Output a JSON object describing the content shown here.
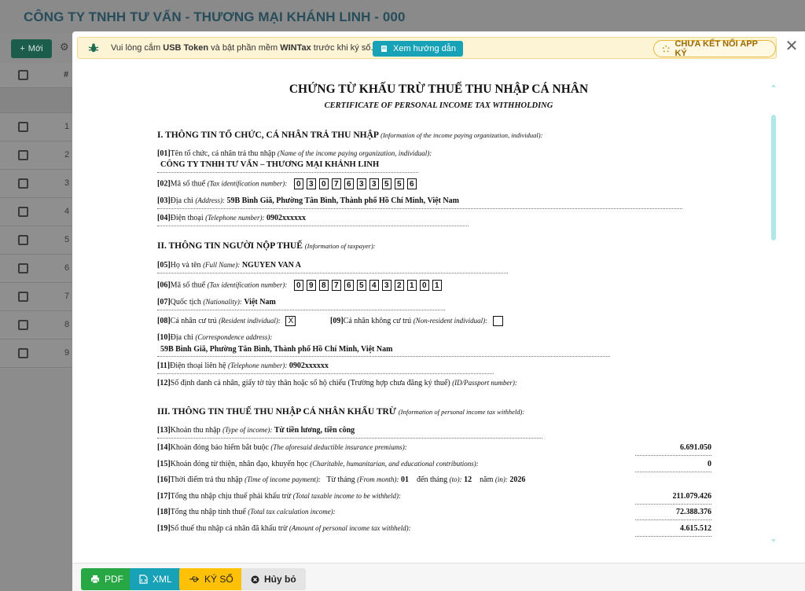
{
  "background": {
    "company_title": "CÔNG TY TNHH TƯ VẤN - THƯƠNG MẠI KHÁNH LINH    - 000",
    "new_button": "Mới",
    "header_hash": "#",
    "row_numbers": [
      "1",
      "2",
      "3",
      "4",
      "5",
      "6",
      "7",
      "8",
      "9"
    ]
  },
  "notice": {
    "text_prefix": "Vui lòng cắm ",
    "text_bold1": "USB Token",
    "text_mid": " và bật phần mềm ",
    "text_bold2": "WINTax",
    "text_suffix": " trước khi ký số.",
    "guide_button": "Xem hướng dẫn",
    "status": "CHƯA KẾT NỐI APP KÝ"
  },
  "document": {
    "title": "CHỨNG TỪ KHẤU TRỪ THUẾ THU NHẬP CÁ NHÂN",
    "subtitle": "CERTIFICATE OF PERSONAL INCOME TAX WITHHOLDING",
    "section1": {
      "title": "I. THÔNG TIN TỔ CHỨC, CÁ NHÂN TRẢ THU NHẬP",
      "title_en": "(Information of the income paying organization, individual):",
      "f01_code": "[01]",
      "f01_label": "Tên tổ chức, cá nhân trả thu nhập",
      "f01_label_en": "(Name of the income paying organization, individual):",
      "f01_value": "CÔNG TY TNHH TƯ VẤN – THƯƠNG MẠI KHÁNH LINH",
      "f02_code": "[02]",
      "f02_label": "Mã số thuế",
      "f02_label_en": "(Tax identification number):",
      "f02_digits": [
        "0",
        "3",
        "0",
        "7",
        "6",
        "3",
        "3",
        "5",
        "5",
        "6"
      ],
      "f03_code": "[03]",
      "f03_label": "Địa chỉ",
      "f03_label_en": "(Address):",
      "f03_value": "59B Bình Giã, Phường Tân Bình, Thành phố Hồ Chí Minh, Việt Nam",
      "f04_code": "[04]",
      "f04_label": "Điện thoại",
      "f04_label_en": "(Telephone number):",
      "f04_value": "0902xxxxxx"
    },
    "section2": {
      "title": "II. THÔNG TIN NGƯỜI NỘP THUẾ",
      "title_en": "(Information of taxpayer):",
      "f05_code": "[05]",
      "f05_label": "Họ và tên",
      "f05_label_en": "(Full Name):",
      "f05_value": "NGUYEN VAN A",
      "f06_code": "[06]",
      "f06_label": "Mã số thuế",
      "f06_label_en": "(Tax identification number):",
      "f06_digits": [
        "0",
        "9",
        "8",
        "7",
        "6",
        "5",
        "4",
        "3",
        "2",
        "1",
        "0",
        "1"
      ],
      "f07_code": "[07]",
      "f07_label": "Quốc tịch",
      "f07_label_en": "(Nationality):",
      "f07_value": "Việt Nam",
      "f08_code": "[08]",
      "f08_label": "Cá nhân cư trú",
      "f08_label_en": "(Resident individual):",
      "f08_mark": "X",
      "f09_code": "[09]",
      "f09_label": "Cá nhân không cư trú",
      "f09_label_en": "(Non-resident individual):",
      "f10_code": "[10]",
      "f10_label": "Địa chỉ",
      "f10_label_en": "(Correspondence address):",
      "f10_value": "59B Bình Giã, Phường Tân Bình, Thành phố Hồ Chí Minh, Việt Nam",
      "f11_code": "[11]",
      "f11_label": "Điện thoại liên hệ",
      "f11_label_en": "(Telephone number):",
      "f11_value": "0902xxxxxx",
      "f12_code": "[12]",
      "f12_label": "Số định danh cá nhân, giấy tờ tùy thân hoặc số hộ chiếu (Trường hợp chưa đăng ký thuế)",
      "f12_label_en": "(ID/Passport number):"
    },
    "section3": {
      "title": "III. THÔNG TIN THUẾ THU NHẬP CÁ NHÂN KHẤU TRỪ",
      "title_en": "(Information of personal income tax withheld):",
      "f13_code": "[13]",
      "f13_label": "Khoản thu nhập",
      "f13_label_en": "(Type of income):",
      "f13_value": "Từ tiền lương, tiền công",
      "f14_code": "[14]",
      "f14_label": "Khoản đóng bảo hiểm bắt buộc",
      "f14_label_en": "(The aforesaid deductible insurance premiums):",
      "f14_value": "6.691.050",
      "f15_code": "[15]",
      "f15_label": "Khoản đóng từ thiện, nhân đạo, khuyến học",
      "f15_label_en": "(Charitable, humanitarian, and educational contributions):",
      "f15_value": "0",
      "f16_code": "[16]",
      "f16_label": "Thời điểm trả thu nhập",
      "f16_label_en": "(Time of income payment):",
      "f16_from_label": "Từ tháng",
      "f16_from_label_en": "(From month):",
      "f16_from": "01",
      "f16_to_label": "đến tháng",
      "f16_to_label_en": "(to):",
      "f16_to": "12",
      "f16_year_label": "năm",
      "f16_year_label_en": "(in):",
      "f16_year": "2026",
      "f17_code": "[17]",
      "f17_label": "Tổng thu nhập chịu thuế phải khấu trừ",
      "f17_label_en": "(Total taxable income to be withheld):",
      "f17_value": "211.079.426",
      "f18_code": "[18]",
      "f18_label": "Tổng thu nhập tính thuế",
      "f18_label_en": "(Total tax calculation income):",
      "f18_value": "72.388.376",
      "f19_code": "[19]",
      "f19_label": "Số thuế thu nhập cá nhân đã khấu trừ",
      "f19_label_en": "(Amount of personal income tax withheld):",
      "f19_value": "4.615.512"
    }
  },
  "footer": {
    "pdf": "PDF",
    "xml": "XML",
    "sign": "KÝ SỐ",
    "cancel": "Hủy bỏ"
  },
  "colors": {
    "green": "#28a745",
    "teal": "#17a2b8",
    "yellow": "#ffc107",
    "notice_bg": "#fdf3d5"
  }
}
